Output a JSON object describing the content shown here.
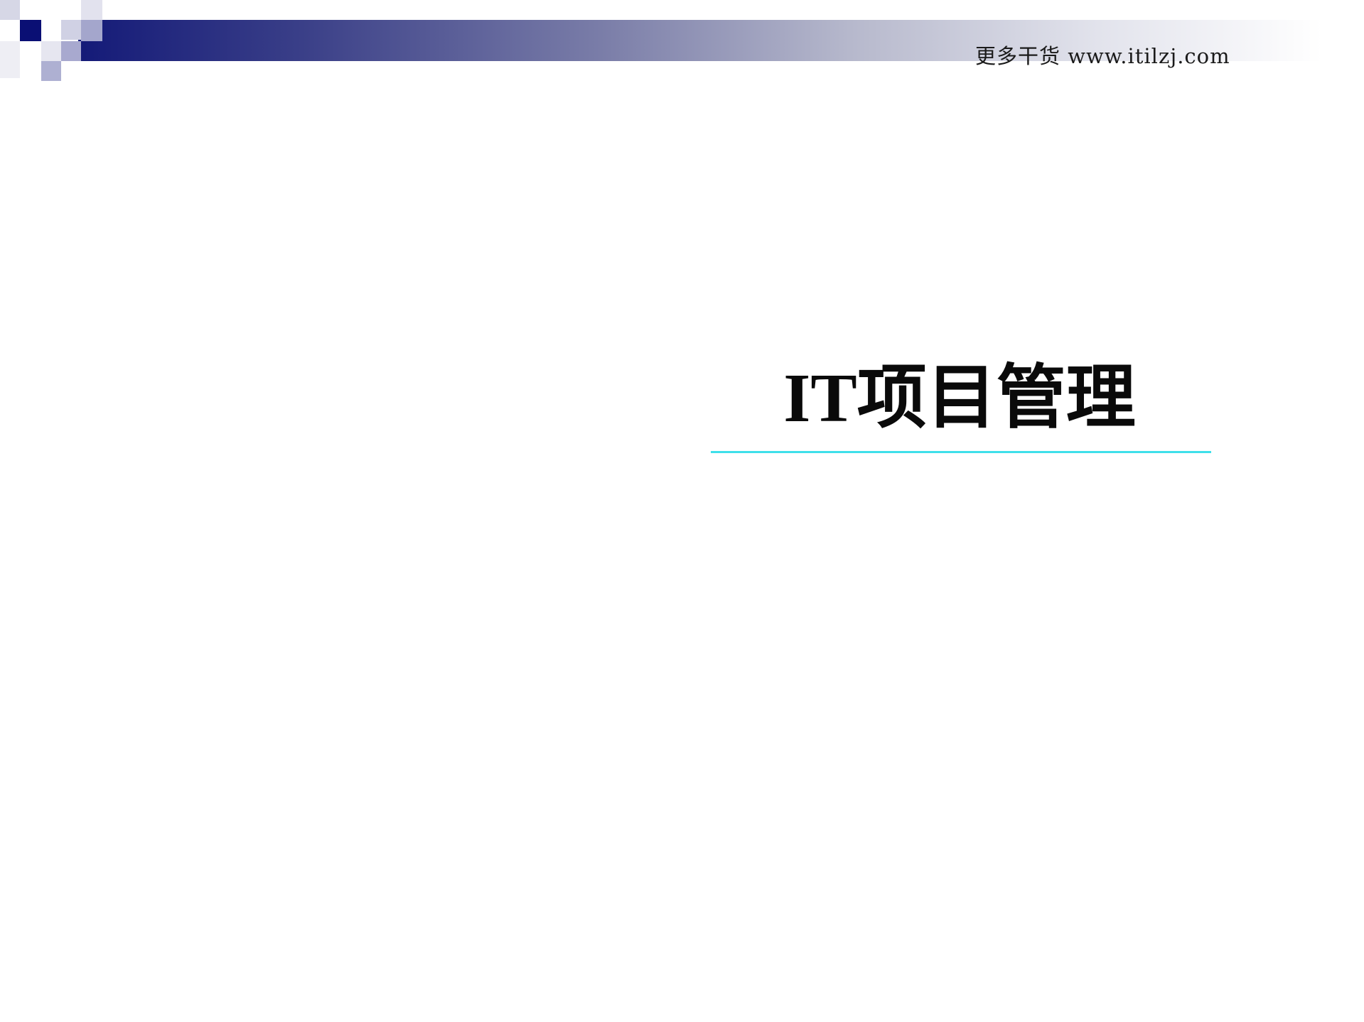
{
  "header": {
    "text": "更多干货 www.itilzj.com"
  },
  "slide": {
    "title": "IT项目管理"
  },
  "colors": {
    "band_start": "#141a78",
    "band_end": "#ffffff",
    "accent_square": "#0a0f74",
    "title_rule": "#3fe0ea",
    "title_text": "#0a0a0a"
  }
}
